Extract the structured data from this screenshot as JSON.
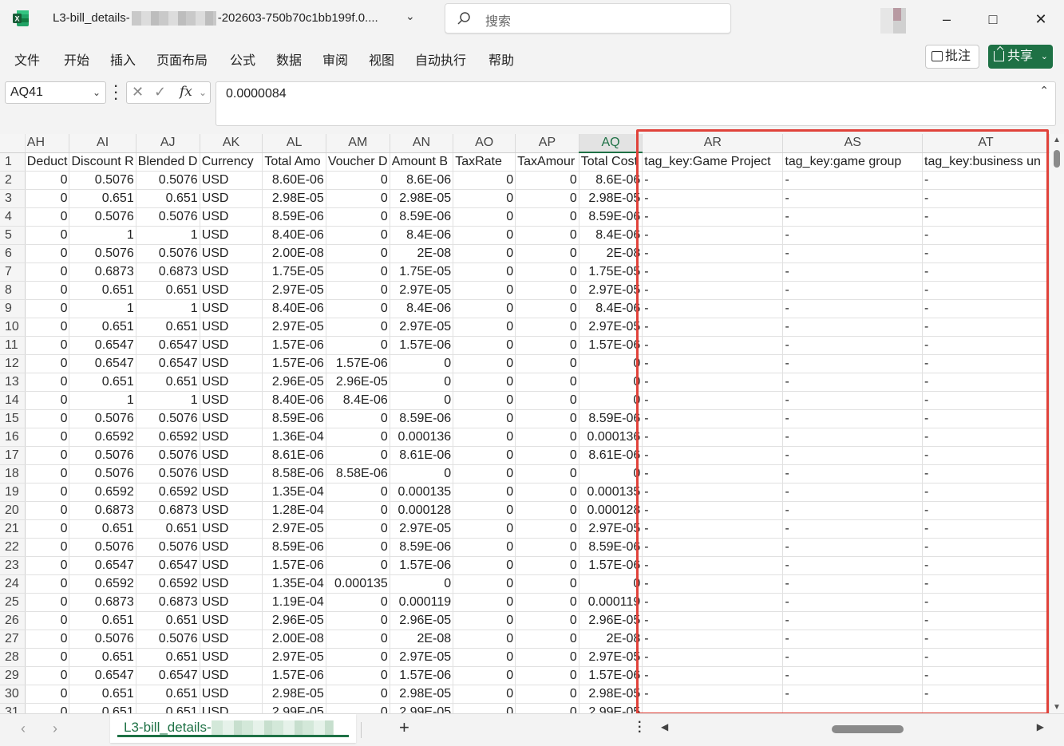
{
  "app": {
    "title_prefix": "L3-bill_details-",
    "title_suffix": "-202603-750b70c1bb199f.0....",
    "search_placeholder": "搜索",
    "colors": {
      "accent": "#1e7145",
      "highlight": "#e0423a"
    }
  },
  "menu": [
    "文件",
    "开始",
    "插入",
    "页面布局",
    "公式",
    "数据",
    "审阅",
    "视图",
    "自动执行",
    "帮助"
  ],
  "actions": {
    "comment": "批注",
    "share": "共享"
  },
  "formula_bar": {
    "name_box": "AQ41",
    "fx_label": "fx",
    "value": "0.0000084"
  },
  "columns": [
    "AH",
    "AI",
    "AJ",
    "AK",
    "AL",
    "AM",
    "AN",
    "AO",
    "AP",
    "AQ",
    "AR",
    "AS",
    "AT"
  ],
  "selected_column": "AQ",
  "header_row": [
    "Deduct",
    "Discount R",
    "Blended D",
    "Currency",
    "Total Amo",
    "Voucher D",
    "Amount B",
    "TaxRate",
    "TaxAmour",
    "Total Cost",
    "tag_key:Game Project",
    "tag_key:game group",
    "tag_key:business un"
  ],
  "rows": [
    {
      "n": "2",
      "c": [
        "0",
        "0.5076",
        "0.5076",
        "USD",
        "8.60E-06",
        "0",
        "8.6E-06",
        "0",
        "0",
        "8.6E-06",
        "-",
        "-",
        "-"
      ]
    },
    {
      "n": "3",
      "c": [
        "0",
        "0.651",
        "0.651",
        "USD",
        "2.98E-05",
        "0",
        "2.98E-05",
        "0",
        "0",
        "2.98E-05",
        "-",
        "-",
        "-"
      ]
    },
    {
      "n": "4",
      "c": [
        "0",
        "0.5076",
        "0.5076",
        "USD",
        "8.59E-06",
        "0",
        "8.59E-06",
        "0",
        "0",
        "8.59E-06",
        "-",
        "-",
        "-"
      ]
    },
    {
      "n": "5",
      "c": [
        "0",
        "1",
        "1",
        "USD",
        "8.40E-06",
        "0",
        "8.4E-06",
        "0",
        "0",
        "8.4E-06",
        "-",
        "-",
        "-"
      ]
    },
    {
      "n": "6",
      "c": [
        "0",
        "0.5076",
        "0.5076",
        "USD",
        "2.00E-08",
        "0",
        "2E-08",
        "0",
        "0",
        "2E-08",
        "-",
        "-",
        "-"
      ]
    },
    {
      "n": "7",
      "c": [
        "0",
        "0.6873",
        "0.6873",
        "USD",
        "1.75E-05",
        "0",
        "1.75E-05",
        "0",
        "0",
        "1.75E-05",
        "-",
        "-",
        "-"
      ]
    },
    {
      "n": "8",
      "c": [
        "0",
        "0.651",
        "0.651",
        "USD",
        "2.97E-05",
        "0",
        "2.97E-05",
        "0",
        "0",
        "2.97E-05",
        "-",
        "-",
        "-"
      ]
    },
    {
      "n": "9",
      "c": [
        "0",
        "1",
        "1",
        "USD",
        "8.40E-06",
        "0",
        "8.4E-06",
        "0",
        "0",
        "8.4E-06",
        "-",
        "-",
        "-"
      ]
    },
    {
      "n": "10",
      "c": [
        "0",
        "0.651",
        "0.651",
        "USD",
        "2.97E-05",
        "0",
        "2.97E-05",
        "0",
        "0",
        "2.97E-05",
        "-",
        "-",
        "-"
      ]
    },
    {
      "n": "11",
      "c": [
        "0",
        "0.6547",
        "0.6547",
        "USD",
        "1.57E-06",
        "0",
        "1.57E-06",
        "0",
        "0",
        "1.57E-06",
        "-",
        "-",
        "-"
      ]
    },
    {
      "n": "12",
      "c": [
        "0",
        "0.6547",
        "0.6547",
        "USD",
        "1.57E-06",
        "1.57E-06",
        "0",
        "0",
        "0",
        "0",
        "-",
        "-",
        "-"
      ]
    },
    {
      "n": "13",
      "c": [
        "0",
        "0.651",
        "0.651",
        "USD",
        "2.96E-05",
        "2.96E-05",
        "0",
        "0",
        "0",
        "0",
        "-",
        "-",
        "-"
      ]
    },
    {
      "n": "14",
      "c": [
        "0",
        "1",
        "1",
        "USD",
        "8.40E-06",
        "8.4E-06",
        "0",
        "0",
        "0",
        "0",
        "-",
        "-",
        "-"
      ]
    },
    {
      "n": "15",
      "c": [
        "0",
        "0.5076",
        "0.5076",
        "USD",
        "8.59E-06",
        "0",
        "8.59E-06",
        "0",
        "0",
        "8.59E-06",
        "-",
        "-",
        "-"
      ]
    },
    {
      "n": "16",
      "c": [
        "0",
        "0.6592",
        "0.6592",
        "USD",
        "1.36E-04",
        "0",
        "0.000136",
        "0",
        "0",
        "0.000136",
        "-",
        "-",
        "-"
      ]
    },
    {
      "n": "17",
      "c": [
        "0",
        "0.5076",
        "0.5076",
        "USD",
        "8.61E-06",
        "0",
        "8.61E-06",
        "0",
        "0",
        "8.61E-06",
        "-",
        "-",
        "-"
      ]
    },
    {
      "n": "18",
      "c": [
        "0",
        "0.5076",
        "0.5076",
        "USD",
        "8.58E-06",
        "8.58E-06",
        "0",
        "0",
        "0",
        "0",
        "-",
        "-",
        "-"
      ]
    },
    {
      "n": "19",
      "c": [
        "0",
        "0.6592",
        "0.6592",
        "USD",
        "1.35E-04",
        "0",
        "0.000135",
        "0",
        "0",
        "0.000135",
        "-",
        "-",
        "-"
      ]
    },
    {
      "n": "20",
      "c": [
        "0",
        "0.6873",
        "0.6873",
        "USD",
        "1.28E-04",
        "0",
        "0.000128",
        "0",
        "0",
        "0.000128",
        "-",
        "-",
        "-"
      ]
    },
    {
      "n": "21",
      "c": [
        "0",
        "0.651",
        "0.651",
        "USD",
        "2.97E-05",
        "0",
        "2.97E-05",
        "0",
        "0",
        "2.97E-05",
        "-",
        "-",
        "-"
      ]
    },
    {
      "n": "22",
      "c": [
        "0",
        "0.5076",
        "0.5076",
        "USD",
        "8.59E-06",
        "0",
        "8.59E-06",
        "0",
        "0",
        "8.59E-06",
        "-",
        "-",
        "-"
      ]
    },
    {
      "n": "23",
      "c": [
        "0",
        "0.6547",
        "0.6547",
        "USD",
        "1.57E-06",
        "0",
        "1.57E-06",
        "0",
        "0",
        "1.57E-06",
        "-",
        "-",
        "-"
      ]
    },
    {
      "n": "24",
      "c": [
        "0",
        "0.6592",
        "0.6592",
        "USD",
        "1.35E-04",
        "0.000135",
        "0",
        "0",
        "0",
        "0",
        "-",
        "-",
        "-"
      ]
    },
    {
      "n": "25",
      "c": [
        "0",
        "0.6873",
        "0.6873",
        "USD",
        "1.19E-04",
        "0",
        "0.000119",
        "0",
        "0",
        "0.000119",
        "-",
        "-",
        "-"
      ]
    },
    {
      "n": "26",
      "c": [
        "0",
        "0.651",
        "0.651",
        "USD",
        "2.96E-05",
        "0",
        "2.96E-05",
        "0",
        "0",
        "2.96E-05",
        "-",
        "-",
        "-"
      ]
    },
    {
      "n": "27",
      "c": [
        "0",
        "0.5076",
        "0.5076",
        "USD",
        "2.00E-08",
        "0",
        "2E-08",
        "0",
        "0",
        "2E-08",
        "-",
        "-",
        "-"
      ]
    },
    {
      "n": "28",
      "c": [
        "0",
        "0.651",
        "0.651",
        "USD",
        "2.97E-05",
        "0",
        "2.97E-05",
        "0",
        "0",
        "2.97E-05",
        "-",
        "-",
        "-"
      ]
    },
    {
      "n": "29",
      "c": [
        "0",
        "0.6547",
        "0.6547",
        "USD",
        "1.57E-06",
        "0",
        "1.57E-06",
        "0",
        "0",
        "1.57E-06",
        "-",
        "-",
        "-"
      ]
    },
    {
      "n": "30",
      "c": [
        "0",
        "0.651",
        "0.651",
        "USD",
        "2.98E-05",
        "0",
        "2.98E-05",
        "0",
        "0",
        "2.98E-05",
        "-",
        "-",
        "-"
      ]
    },
    {
      "n": "31",
      "c": [
        "0",
        "0.651",
        "0.651",
        "USD",
        "2.99E-05",
        "0",
        "2.99E-05",
        "0",
        "0",
        "2.99E-05",
        "",
        "",
        ""
      ]
    }
  ],
  "sheet_tab": {
    "label_prefix": "L3-bill_details-"
  }
}
